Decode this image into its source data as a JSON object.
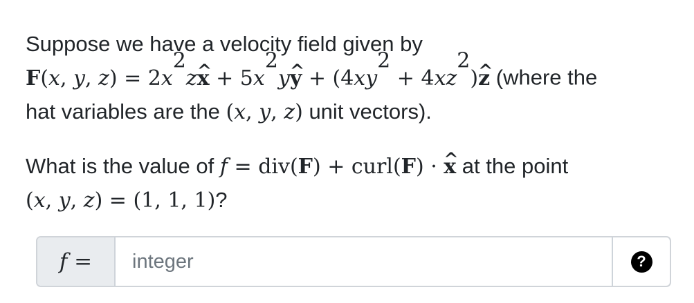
{
  "question": {
    "intro": "Suppose we have a velocity field given by",
    "field_formula": "F(x,y,z) = 2x²z x̂ + 5x²y ŷ + (4xy² + 4xz²) ẑ",
    "field_note": "(where the",
    "field_note_line2": "hat variables are the",
    "field_note_vars": "(x, y, z)",
    "field_note_end": "unit vectors).",
    "prompt_start": "What is the value of",
    "prompt_formula": "f = div(F) + curl(F) · x̂",
    "prompt_mid": "at the point",
    "point_formula": "(x, y, z) = (1, 1, 1)",
    "prompt_end": "?"
  },
  "answer": {
    "label": "f =",
    "placeholder": "integer",
    "value": "",
    "help_icon": "?"
  }
}
